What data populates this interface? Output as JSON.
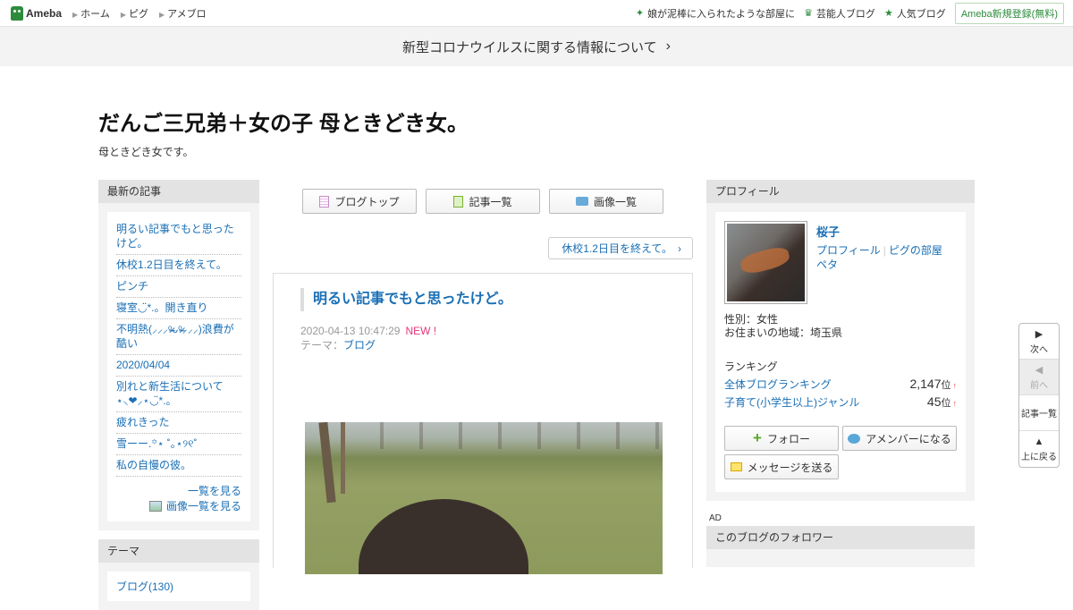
{
  "topbar": {
    "logo_text": "Ameba",
    "nav": [
      "ホーム",
      "ピグ",
      "アメブロ"
    ],
    "right": [
      {
        "icon": "sparkle-icon",
        "label": "娘が泥棒に入られたような部屋に"
      },
      {
        "icon": "crown-icon",
        "label": "芸能人ブログ"
      },
      {
        "icon": "star-icon",
        "label": "人気ブログ"
      }
    ],
    "register_label": "Ameba新規登録(無料)"
  },
  "notice": {
    "text": "新型コロナウイルスに関する情報について"
  },
  "blog": {
    "title": "だんご三兄弟＋女の子 母ときどき女。",
    "description": "母ときどき女です。"
  },
  "recent": {
    "heading": "最新の記事",
    "items": [
      "明るい記事でもと思ったけど。",
      "休校1.2日目を終えて。",
      "ピンチ",
      "寝室◡̈*.。開き直り",
      "不明熱(⸝⸝⸝ᵒ̴̶̷ᴗᵒ̴̶̷⸝⸝⸝)浪費が酷い",
      "2020/04/04",
      "別れと新生活について⋆⸜❤︎⸝‍⋆◡̈*.。",
      "疲れきった",
      "雪ーー.꙳⋆ ˚｡⋆୨୧˚",
      "私の自慢の彼。"
    ],
    "see_all": "一覧を見る",
    "see_images": "画像一覧を見る"
  },
  "theme": {
    "heading": "テーマ",
    "first": "ブログ(130)"
  },
  "tabs": [
    "ブログトップ",
    "記事一覧",
    "画像一覧"
  ],
  "prev_entry": "休校1.2日目を終えて。",
  "article": {
    "title": "明るい記事でもと思ったけど。",
    "datetime": "2020-04-13 10:47:29",
    "new_badge": "NEW !",
    "theme_label": "テーマ：",
    "theme": "ブログ"
  },
  "profile": {
    "heading": "プロフィール",
    "name": "桜子",
    "link_profile": "プロフィール",
    "link_pig": "ピグの部屋",
    "link_peta": "ペタ",
    "gender": "性別：女性",
    "location": "お住まいの地域：埼玉県",
    "ranking_heading": "ランキング",
    "rankings": [
      {
        "label": "全体ブログランキング",
        "value": "2,147",
        "unit": "位",
        "trend": "↑"
      },
      {
        "label": "子育て(小学生以上)ジャンル",
        "value": "45",
        "unit": "位",
        "trend": "↑"
      }
    ],
    "follow_label": "フォロー",
    "member_label": "アメンバーになる",
    "message_label": "メッセージを送る"
  },
  "ad_label": "AD",
  "followers": {
    "heading": "このブログのフォロワー"
  },
  "floatnav": {
    "next": "次へ",
    "prev": "前へ",
    "list": "記事一覧",
    "top": "上に戻る"
  }
}
